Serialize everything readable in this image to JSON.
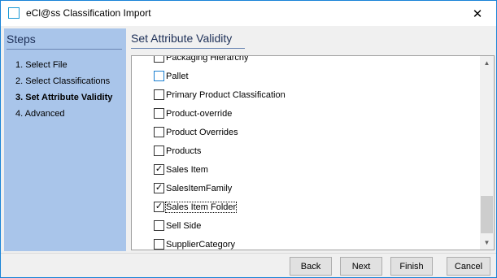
{
  "window": {
    "title": "eCl@ss Classification Import",
    "close_glyph": "✕",
    "app_icon": "window-square-icon"
  },
  "sidebar": {
    "title": "Steps",
    "steps": [
      {
        "label": "1. Select File",
        "current": false
      },
      {
        "label": "2. Select Classifications",
        "current": false
      },
      {
        "label": "3. Set Attribute Validity",
        "current": true
      },
      {
        "label": "4. Advanced",
        "current": false
      }
    ]
  },
  "main": {
    "title": "Set Attribute Validity",
    "items": [
      {
        "label": "Packaging Hierarchy",
        "checked": false
      },
      {
        "label": "Pallet",
        "checked": false
      },
      {
        "label": "Primary Product Classification",
        "checked": false
      },
      {
        "label": "Product-override",
        "checked": false
      },
      {
        "label": "Product Overrides",
        "checked": false
      },
      {
        "label": "Products",
        "checked": false
      },
      {
        "label": "Sales Item",
        "checked": true
      },
      {
        "label": "SalesItemFamily",
        "checked": true
      },
      {
        "label": "Sales Item Folder",
        "checked": true
      },
      {
        "label": "Sell Side",
        "checked": false
      },
      {
        "label": "SupplierCategory",
        "checked": false
      }
    ],
    "check_glyph": "✓",
    "scroll_up_glyph": "▲",
    "scroll_down_glyph": "▼"
  },
  "footer": {
    "back_label": "Back",
    "next_label": "Next",
    "finish_label": "Finish",
    "cancel_label": "Cancel"
  },
  "colors": {
    "sidebar_bg": "#a9c5ea",
    "heading": "#1d2f57",
    "window_border": "#1883d7"
  }
}
